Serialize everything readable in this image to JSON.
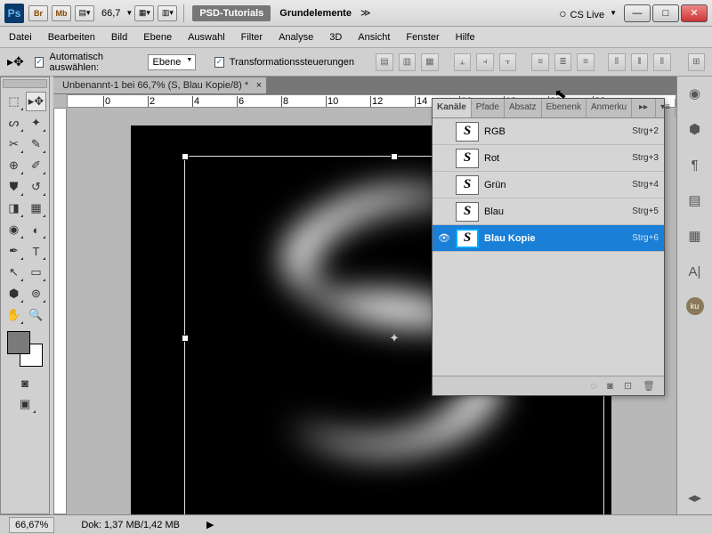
{
  "titlebar": {
    "zoom": "66,7",
    "psd": "PSD-Tutorials",
    "workspace": "Grundelemente",
    "cslive": "CS Live",
    "br": "Br",
    "mb": "Mb"
  },
  "menu": [
    "Datei",
    "Bearbeiten",
    "Bild",
    "Ebene",
    "Auswahl",
    "Filter",
    "Analyse",
    "3D",
    "Ansicht",
    "Fenster",
    "Hilfe"
  ],
  "options": {
    "auto": "Automatisch auswählen:",
    "layer": "Ebene",
    "transform": "Transformationssteuerungen"
  },
  "doc": {
    "tab": "Unbenannt-1 bei 66,7% (S, Blau Kopie/8) *"
  },
  "panel": {
    "tabs": [
      "Kanäle",
      "Pfade",
      "Absatz",
      "Ebenenk",
      "Anmerku"
    ],
    "channels": [
      {
        "name": "RGB",
        "shortcut": "Strg+2",
        "visible": false,
        "selected": false
      },
      {
        "name": "Rot",
        "shortcut": "Strg+3",
        "visible": false,
        "selected": false
      },
      {
        "name": "Grün",
        "shortcut": "Strg+4",
        "visible": false,
        "selected": false
      },
      {
        "name": "Blau",
        "shortcut": "Strg+5",
        "visible": false,
        "selected": false
      },
      {
        "name": "Blau Kopie",
        "shortcut": "Strg+6",
        "visible": true,
        "selected": true
      }
    ]
  },
  "status": {
    "zoom": "66,67%",
    "doc": "Dok: 1,37 MB/1,42 MB"
  }
}
